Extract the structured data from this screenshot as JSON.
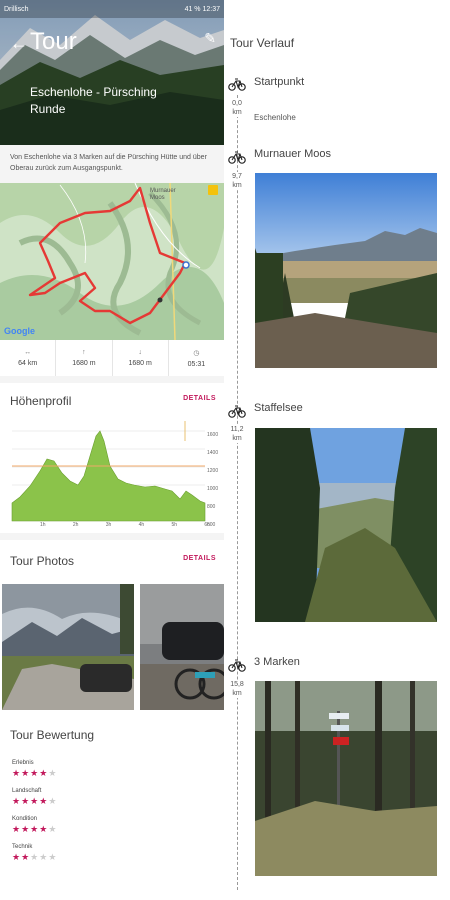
{
  "status_bar": {
    "carrier": "Drillisch",
    "right": "41 %  12:37"
  },
  "header": {
    "back_icon": "back-arrow-icon",
    "title": "Tour",
    "tour_name": "Eschenlohe - Pürsching Runde"
  },
  "description": "Von Eschenlohe via 3 Marken auf die Pürsching Hütte und über Oberau zurück zum Ausgangspunkt.",
  "map": {
    "place_label": "Murnauer Moos",
    "provider": "Google",
    "route_color": "#e53935"
  },
  "stats": [
    {
      "icon": "distance-icon",
      "value": "64 km"
    },
    {
      "icon": "ascent-icon",
      "value": "1680 m"
    },
    {
      "icon": "descent-icon",
      "value": "1680 m"
    },
    {
      "icon": "time-icon",
      "value": "05:31"
    }
  ],
  "profile": {
    "title": "Höhenprofil",
    "details_label": "DETAILS",
    "y_ticks": [
      "1600",
      "1400",
      "1200",
      "1000",
      "800",
      "600"
    ],
    "x_ticks": [
      "1h",
      "2h",
      "3h",
      "4h",
      "5h",
      "6h"
    ]
  },
  "photos": {
    "title": "Tour Photos",
    "details_label": "DETAILS"
  },
  "rating": {
    "title": "Tour Bewertung",
    "items": [
      {
        "label": "Erlebnis",
        "stars": 4
      },
      {
        "label": "Landschaft",
        "stars": 4
      },
      {
        "label": "Kondition",
        "stars": 4
      },
      {
        "label": "Technik",
        "stars": 2
      }
    ],
    "max_stars": 5
  },
  "timeline": {
    "title": "Tour Verlauf",
    "waypoints": [
      {
        "distance": "0,0",
        "unit": "km",
        "name": "Startpunkt",
        "sub": "Eschenlohe"
      },
      {
        "distance": "9,7",
        "unit": "km",
        "name": "Murnauer Moos"
      },
      {
        "distance": "11,2",
        "unit": "km",
        "name": "Staffelsee"
      },
      {
        "distance": "15,8",
        "unit": "km",
        "name": "3 Marken"
      }
    ]
  },
  "colors": {
    "accent": "#c2185b",
    "profile_fill": "#8bc34a"
  }
}
